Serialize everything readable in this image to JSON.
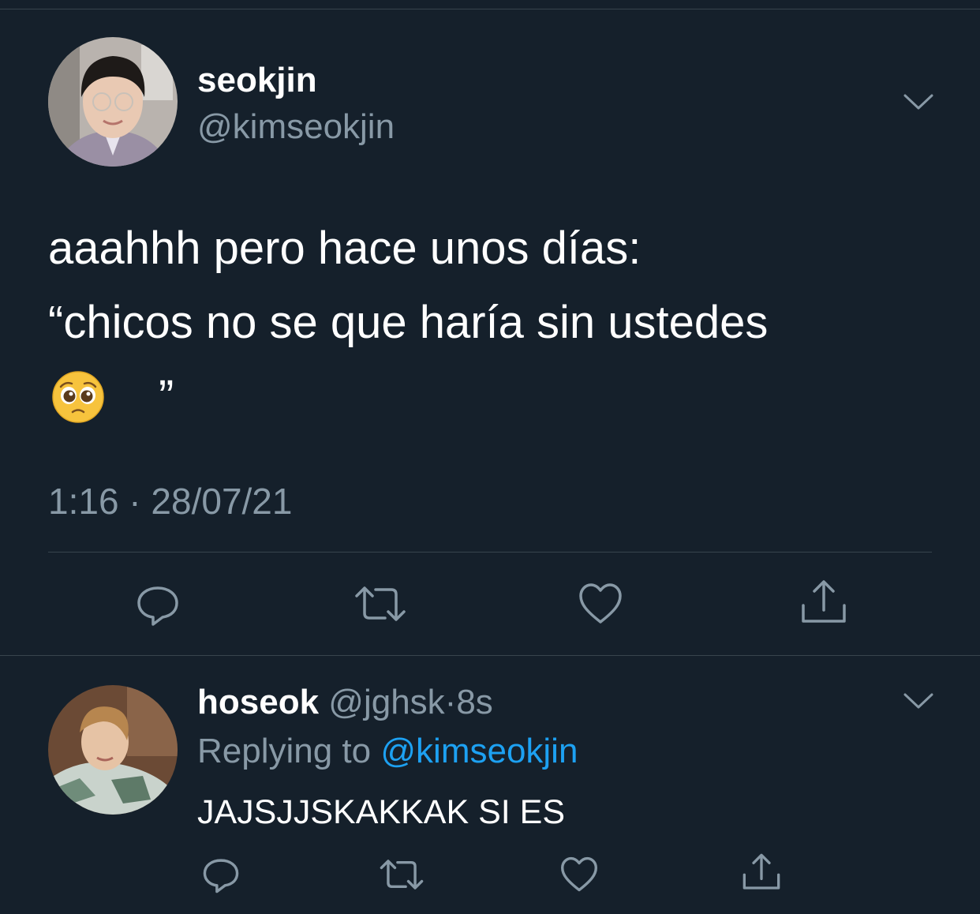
{
  "colors": {
    "background": "#15202b",
    "secondary_text": "#8899a6",
    "link": "#1da1f2",
    "divider": "#38444d"
  },
  "main_tweet": {
    "display_name": "seokjin",
    "handle": "@kimseokjin",
    "text_lines": [
      "aaahhh pero hace unos días:",
      "“chicos no se que haría sin ustedes"
    ],
    "text_end": "”",
    "emoji": "pleading-face",
    "timestamp": "1:16 · 28/07/21",
    "actions": [
      "reply-icon",
      "retweet-icon",
      "like-icon",
      "share-icon"
    ]
  },
  "reply_tweet": {
    "display_name": "hoseok",
    "handle": "@jghsk",
    "separator": "·",
    "time": "8s",
    "replying_label": "Replying to",
    "replying_handle": "@kimseokjin",
    "text": "JAJSJJSKAKKAK SI ES",
    "actions": [
      "reply-icon",
      "retweet-icon",
      "like-icon",
      "share-icon"
    ]
  }
}
